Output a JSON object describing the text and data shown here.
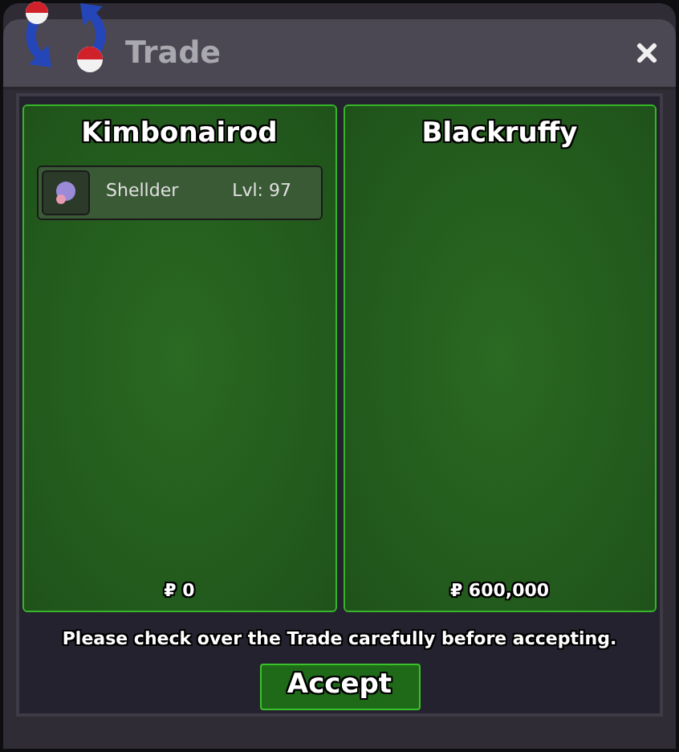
{
  "window": {
    "title": "Trade"
  },
  "offers": [
    {
      "trader": "Kimbonairod",
      "items": [
        {
          "name": "Shellder",
          "level": "Lvl: 97"
        }
      ],
      "money": "₽ 0"
    },
    {
      "trader": "Blackruffy",
      "money": "₽ 600,000"
    }
  ],
  "notice": "Please check over the Trade carefully before accepting.",
  "accept_button": "Accept"
}
